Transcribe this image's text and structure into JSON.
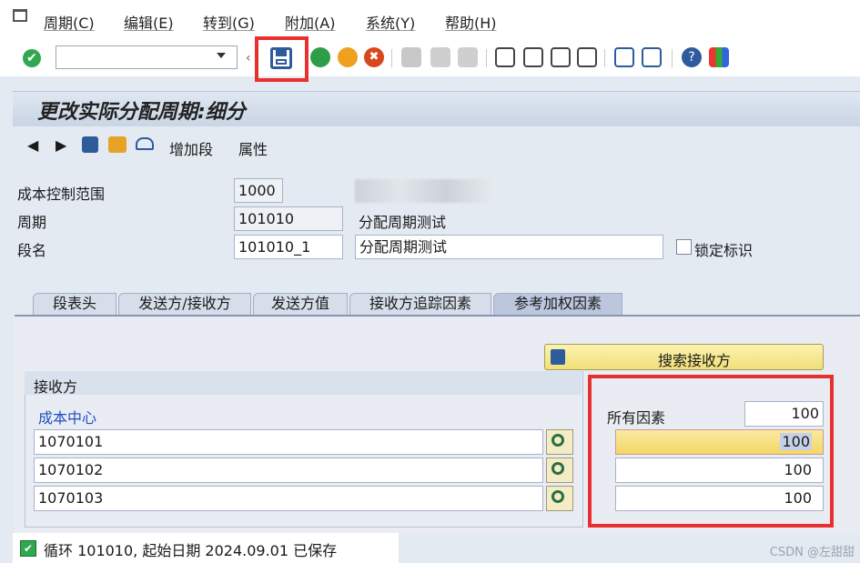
{
  "menu": {
    "items": [
      "周期(C)",
      "编辑(E)",
      "转到(G)",
      "附加(A)",
      "系统(Y)",
      "帮助(H)"
    ]
  },
  "toolbar": {
    "command_field_value": ""
  },
  "title": "更改实际分配周期:细分",
  "app_toolbar": {
    "add_segment": "增加段",
    "attributes": "属性"
  },
  "form": {
    "controlling_area_label": "成本控制范围",
    "controlling_area_value": "1000",
    "cycle_label": "周期",
    "cycle_value": "101010",
    "cycle_desc": "分配周期测试",
    "segment_label": "段名",
    "segment_value": "101010_1",
    "segment_desc": "分配周期测试",
    "lock_label": "锁定标识"
  },
  "tabs": [
    "段表头",
    "发送方/接收方",
    "发送方值",
    "接收方追踪因素",
    "参考加权因素"
  ],
  "tab_panel": {
    "search_button": "搜索接收方",
    "group_title": "接收方",
    "cost_center_label": "成本中心",
    "factor_label": "所有因素",
    "factor_all_value": "100",
    "rows": [
      {
        "cost_center": "1070101",
        "factor": "100"
      },
      {
        "cost_center": "1070102",
        "factor": "100"
      },
      {
        "cost_center": "1070103",
        "factor": "100"
      }
    ]
  },
  "status": {
    "message": "循环 101010, 起始日期 2024.09.01 已保存"
  },
  "watermark": "CSDN @左甜甜",
  "colors": {
    "highlight": "#e8312f",
    "title_bar": "#c9d5e5",
    "link_blue": "#1f4fbf"
  }
}
